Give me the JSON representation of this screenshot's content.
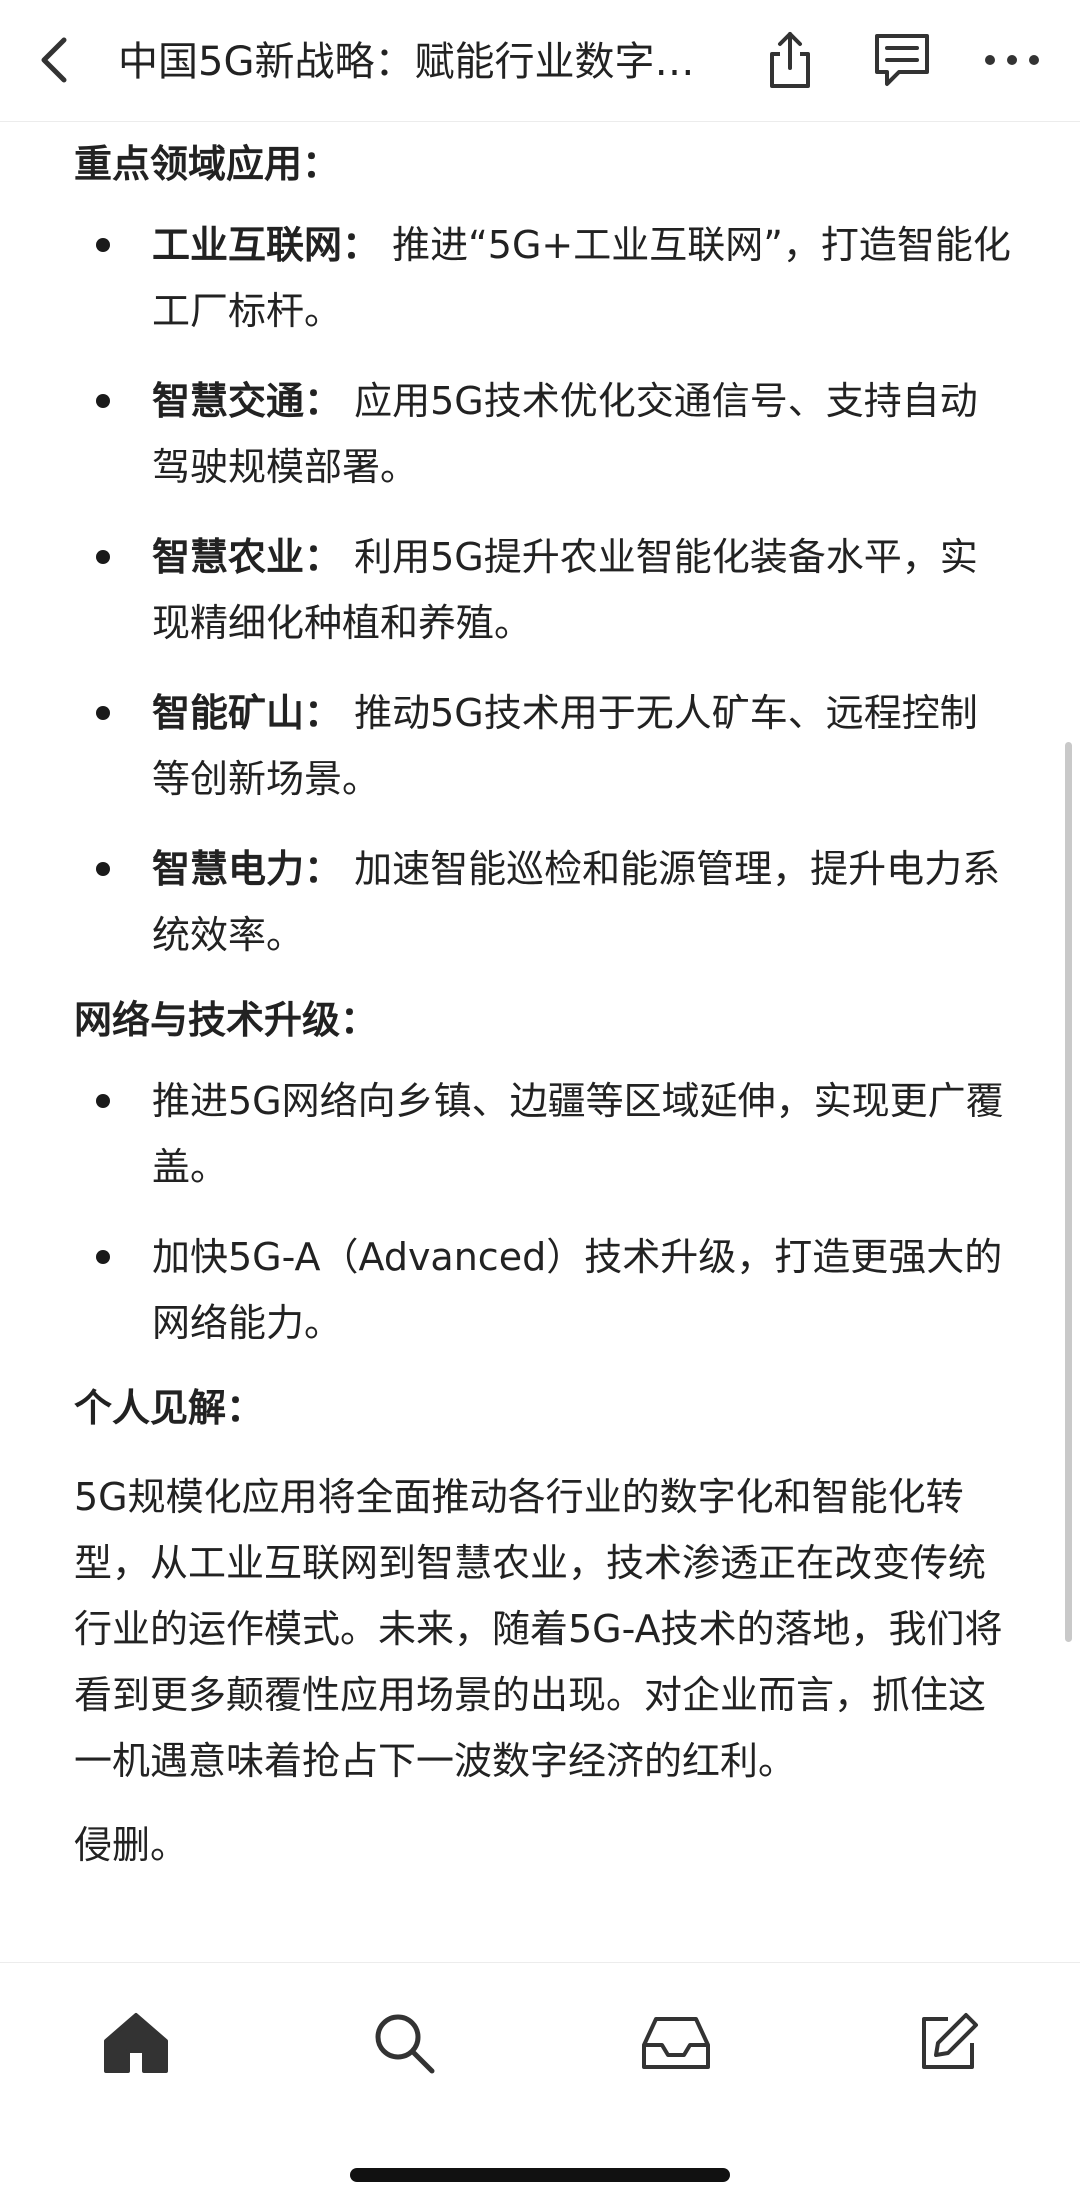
{
  "header": {
    "title": "中国5G新战略：赋能行业数字…",
    "icons": {
      "back": "chevron-left-icon",
      "share": "share-icon",
      "comment": "comment-icon",
      "more": "more-icon"
    }
  },
  "content": {
    "section1": {
      "heading": "重点领域应用：",
      "items": [
        {
          "bold": "工业互联网：",
          "text": " 推进“5G+工业互联网”，打造智能化工厂标杆。"
        },
        {
          "bold": "智慧交通：",
          "text": " 应用5G技术优化交通信号、支持自动驾驶规模部署。"
        },
        {
          "bold": "智慧农业：",
          "text": " 利用5G提升农业智能化装备水平，实现精细化种植和养殖。"
        },
        {
          "bold": "智能矿山：",
          "text": " 推动5G技术用于无人矿车、远程控制等创新场景。"
        },
        {
          "bold": "智慧电力：",
          "text": " 加速智能巡检和能源管理，提升电力系统效率。"
        }
      ]
    },
    "section2": {
      "heading": "网络与技术升级：",
      "items": [
        {
          "text": "推进5G网络向乡镇、边疆等区域延伸，实现更广覆盖。"
        },
        {
          "text": "加快5G-A（Advanced）技术升级，打造更强大的网络能力。"
        }
      ]
    },
    "section3": {
      "heading": "个人见解：",
      "paragraph": "5G规模化应用将全面推动各行业的数字化和智能化转型，从工业互联网到智慧农业，技术渗透正在改变传统行业的运作模式。未来，随着5G-A技术的落地，我们将看到更多颠覆性应用场景的出现。对企业而言，抓住这一机遇意味着抢占下一波数字经济的红利。"
    },
    "footer_text": "侵删。"
  },
  "tabbar": {
    "icons": {
      "home": "home-icon",
      "search": "search-icon",
      "inbox": "inbox-icon",
      "compose": "compose-icon"
    }
  },
  "colors": {
    "text": "#222222",
    "icon": "#333333",
    "background": "#ffffff"
  }
}
